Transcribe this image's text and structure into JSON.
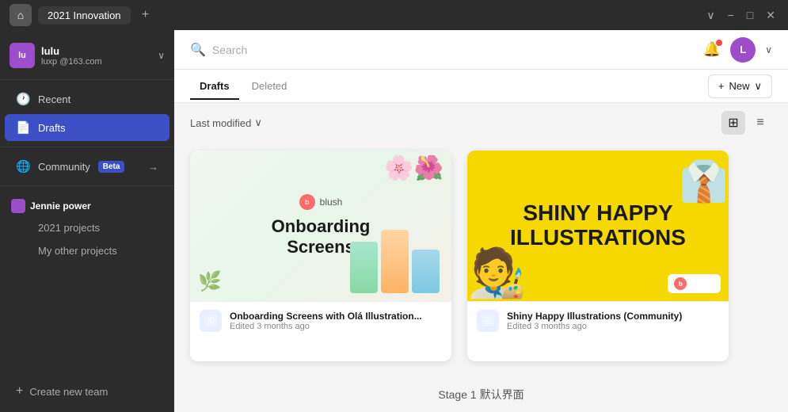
{
  "titlebar": {
    "home_icon": "⌂",
    "tab_name": "2021 Innovation",
    "add_icon": "+",
    "chevron_down": "∨",
    "minimize_icon": "−",
    "maximize_icon": "□",
    "close_icon": "✕"
  },
  "sidebar": {
    "user": {
      "name": "lulu",
      "handle": "luxp",
      "email": "@163.com",
      "avatar_letter": "lu",
      "chevron": "∨"
    },
    "recent_label": "Recent",
    "drafts_label": "Drafts",
    "community_label": "Community",
    "beta_label": "Beta",
    "community_arrow": "→",
    "section_label": "Jennie power",
    "subitem_1": "2021  projects",
    "subitem_2": "My other projects",
    "create_team_label": "Create new team"
  },
  "header": {
    "search_placeholder": "Search",
    "user_letter": "L"
  },
  "tabs": {
    "drafts_label": "Drafts",
    "deleted_label": "Deleted",
    "new_label": "New"
  },
  "toolbar": {
    "sort_label": "Last modified",
    "sort_icon": "∨"
  },
  "cards": [
    {
      "id": "card-1",
      "thumb_logo": "blush",
      "thumb_title_line1": "Onboarding",
      "thumb_title_line2": "Screens",
      "footer_title": "Onboarding Screens with Olá Illustration...",
      "footer_meta": "Edited 3 months ago"
    },
    {
      "id": "card-2",
      "thumb_title_line1": "SHINY HAPPY",
      "thumb_title_line2": "ILLUSTRATIONS",
      "badge_label": "Blush",
      "footer_title": "Shiny Happy Illustrations (Community)",
      "footer_meta": "Edited 3 months ago"
    }
  ],
  "stage_label": "Stage 1 默认界面",
  "colors": {
    "accent": "#3d4fc4",
    "purple": "#9c4dcc",
    "yellow": "#f5d800"
  }
}
